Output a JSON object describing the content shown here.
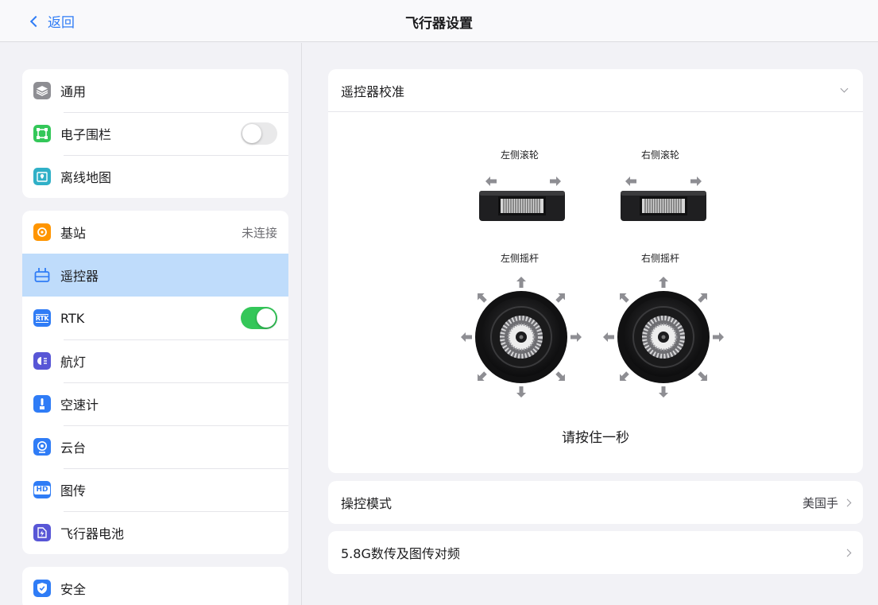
{
  "nav": {
    "back_label": "返回",
    "title": "飞行器设置"
  },
  "sidebar": {
    "groups": [
      {
        "items": [
          {
            "label": "通用",
            "icon": "layers-icon",
            "color": "#8e8e93"
          },
          {
            "label": "电子围栏",
            "icon": "geofence-icon",
            "color": "#34c759",
            "toggle": "off"
          },
          {
            "label": "离线地图",
            "icon": "map-icon",
            "color": "#30b0c7"
          }
        ]
      },
      {
        "items": [
          {
            "label": "基站",
            "icon": "base-station-icon",
            "color": "#ff9500",
            "value": "未连接"
          },
          {
            "label": "遥控器",
            "icon": "remote-controller-icon",
            "color": "#2f7cf6",
            "selected": true
          },
          {
            "label": "RTK",
            "icon": "rtk-icon",
            "icon_text": "RTK",
            "color": "#2f7cf6",
            "toggle": "on"
          },
          {
            "label": "航灯",
            "icon": "nav-light-icon",
            "color": "#5856d6"
          },
          {
            "label": "空速计",
            "icon": "airspeed-icon",
            "color": "#2f7cf6"
          },
          {
            "label": "云台",
            "icon": "gimbal-icon",
            "color": "#2f7cf6"
          },
          {
            "label": "图传",
            "icon": "hd-transmission-icon",
            "icon_text": "HD",
            "color": "#2f7cf6"
          },
          {
            "label": "飞行器电池",
            "icon": "battery-icon",
            "color": "#5856d6"
          }
        ]
      },
      {
        "items": [
          {
            "label": "安全",
            "icon": "shield-icon",
            "color": "#2f7cf6"
          }
        ]
      }
    ]
  },
  "calibration": {
    "title": "遥控器校准",
    "left_wheel": "左侧滚轮",
    "right_wheel": "右侧滚轮",
    "left_stick": "左侧摇杆",
    "right_stick": "右侧摇杆",
    "hint": "请按住一秒"
  },
  "control_mode": {
    "label": "操控模式",
    "value": "美国手"
  },
  "frequency": {
    "label": "5.8G数传及图传对频"
  },
  "colors": {
    "accent": "#2f7cf6",
    "toggle_on": "#34c759",
    "selected_row": "#bfdcfb"
  }
}
